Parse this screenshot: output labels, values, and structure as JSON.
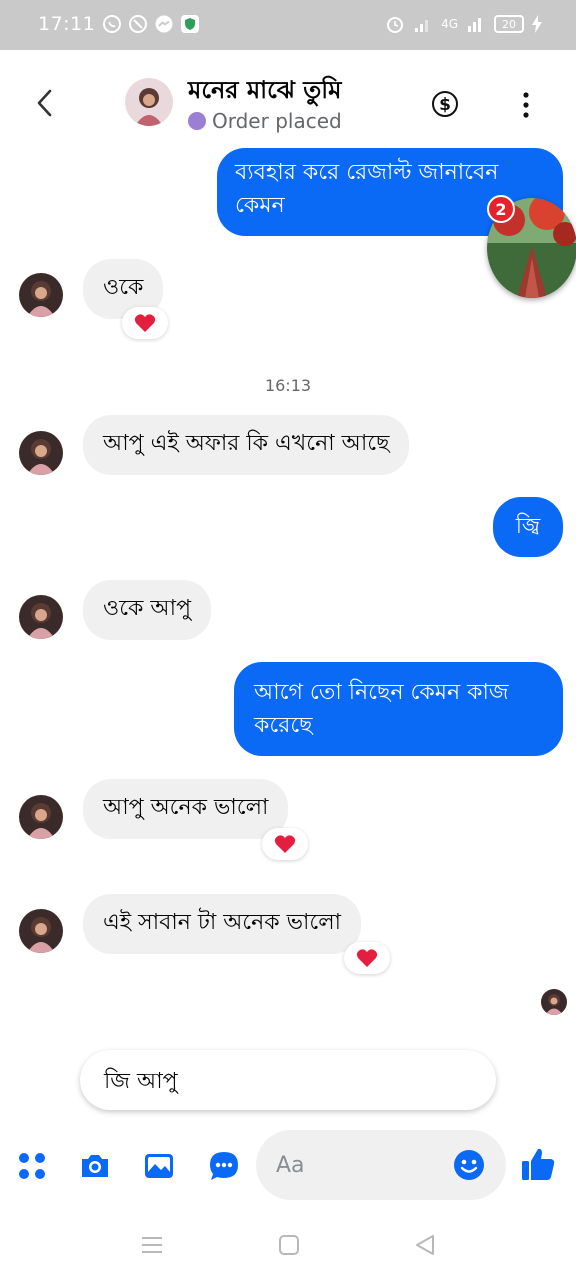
{
  "status_bar": {
    "time": "17:11",
    "network": "4G",
    "battery": "20"
  },
  "header": {
    "contact_name": "মনের মাঝে তুমি",
    "status_text": "Order placed",
    "status_color": "#9b7fd4"
  },
  "messages": [
    {
      "id": "m1",
      "direction": "outgoing",
      "text_lines": [
        "ব্যবহার করে রেজাল্ট জানাবেন",
        "কেমন"
      ]
    },
    {
      "id": "m2",
      "direction": "incoming",
      "text": "ওকে",
      "reaction": "heart"
    },
    {
      "id": "m3",
      "direction": "incoming",
      "text": "আপু এই অফার কি এখনো আছে"
    },
    {
      "id": "m4",
      "direction": "outgoing",
      "text": "জ্বি"
    },
    {
      "id": "m5",
      "direction": "incoming",
      "text": "ওকে আপু"
    },
    {
      "id": "m6",
      "direction": "outgoing",
      "text_lines": [
        "আগে তো নিছেন কেমন কাজ",
        "করেছে"
      ]
    },
    {
      "id": "m7",
      "direction": "incoming",
      "text": "আপু অনেক ভালো",
      "reaction": "heart"
    },
    {
      "id": "m8",
      "direction": "incoming",
      "text": "এই সাবান টা অনেক ভালো",
      "reaction": "heart"
    }
  ],
  "timestamp": "16:13",
  "chat_head": {
    "unread_count": "2"
  },
  "quick_reply": {
    "text": "জি আপু"
  },
  "composer": {
    "placeholder": "Aa"
  },
  "colors": {
    "outgoing_bubble": "#0a69f5",
    "incoming_bubble": "#f0f0f0",
    "accent": "#0a69f5",
    "reaction_heart": "#e41e3f",
    "badge": "#e4232b"
  },
  "icons": {
    "back": "chevron-left-icon",
    "payment": "dollar-circle-icon",
    "more": "vertical-dots-icon",
    "apps": "four-dots-icon",
    "camera": "camera-icon",
    "gallery": "image-icon",
    "chat": "chat-bubble-icon",
    "emoji": "smiley-icon",
    "like": "thumbs-up-icon"
  }
}
